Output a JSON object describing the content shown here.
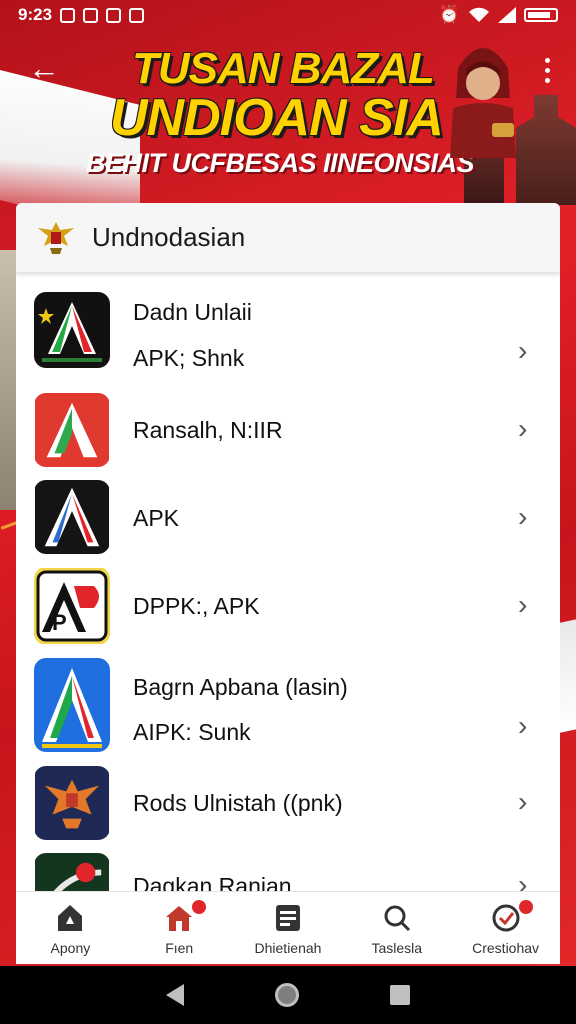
{
  "status_bar": {
    "time": "9:23",
    "left_icons": [
      "notification-icon",
      "notification-icon",
      "notification-icon",
      "notification-icon",
      "notification-icon"
    ],
    "right_icons": [
      "alarm-icon",
      "wifi-icon",
      "signal-icon",
      "battery-icon"
    ]
  },
  "banner": {
    "title_line1": "TUSAN BAZAL",
    "title_line2": "UNDIOAN SIA",
    "subtitle": "BEHIT UCFBESAS IINEONSIAS"
  },
  "panel": {
    "title": "Undnodasian"
  },
  "apps": [
    {
      "line1": "Dadn Unlaii",
      "line2": "APK; Shnk",
      "icon": "a-logo-black-icon"
    },
    {
      "line1": "Ransalh, N:IIR",
      "line2": "",
      "icon": "a-logo-red-icon"
    },
    {
      "line1": "APK",
      "line2": "",
      "icon": "a-logo-dark-icon"
    },
    {
      "line1": "DPPK:, APK",
      "line2": "",
      "icon": "ap-logo-icon"
    },
    {
      "line1": "Bagrn Apbana (lasin)",
      "line2": "AIPK: Sunk",
      "icon": "a-logo-blue-icon"
    },
    {
      "line1": "Rods Ulnistah ((pnk)",
      "line2": "",
      "icon": "garuda-icon"
    },
    {
      "line1": "Dagkan Ranian",
      "line2": "",
      "icon": "green-logo-icon"
    }
  ],
  "bottom_nav": [
    {
      "label": "Apony",
      "icon": "home-icon"
    },
    {
      "label": "Fıen",
      "icon": "house-badge-icon"
    },
    {
      "label": "Dhietienah",
      "icon": "list-icon"
    },
    {
      "label": "Taslesla",
      "icon": "search-icon"
    },
    {
      "label": "Crestiohav",
      "icon": "profile-check-icon"
    }
  ],
  "colors": {
    "brand_red": "#d71920",
    "banner_yellow": "#ffd200",
    "badge_red": "#e0262b"
  }
}
